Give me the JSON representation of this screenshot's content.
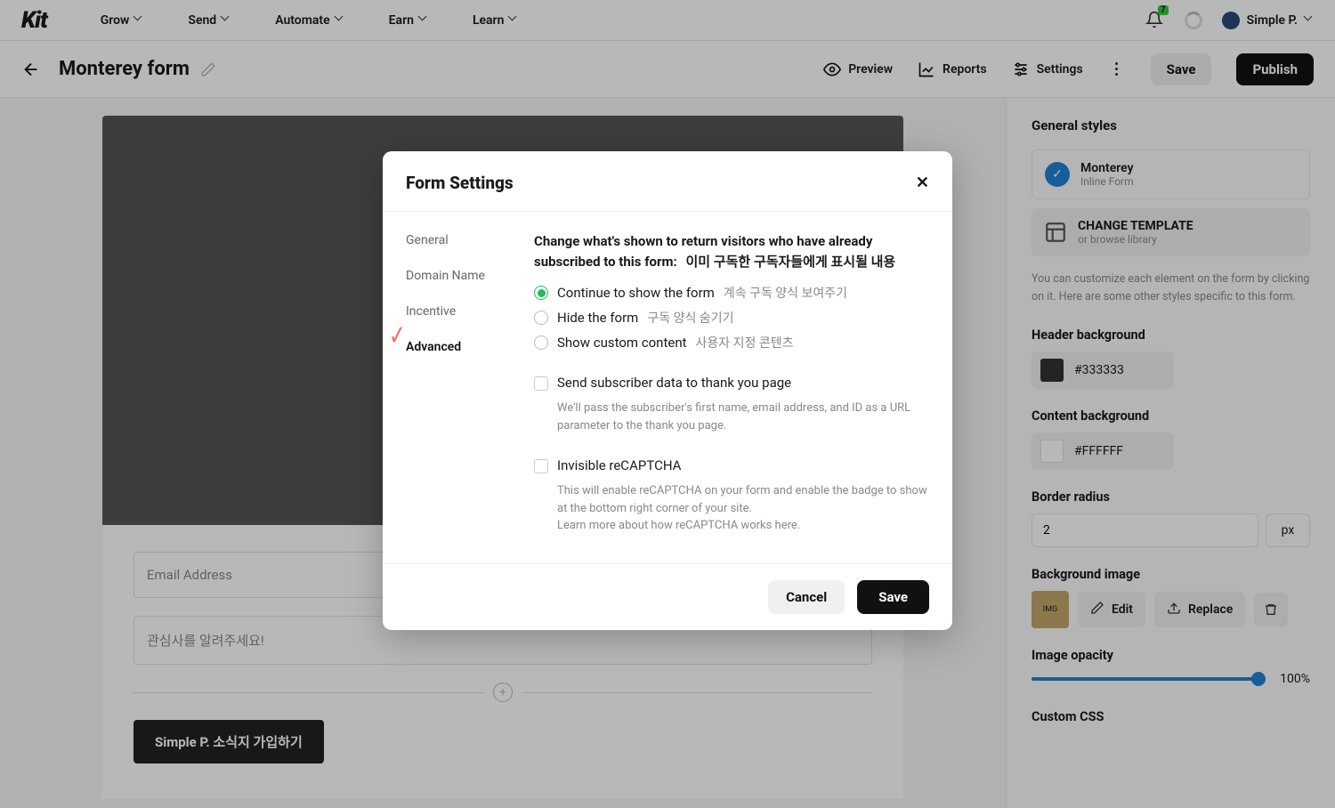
{
  "brand": "Kit",
  "topnav": {
    "grow": "Grow",
    "send": "Send",
    "automate": "Automate",
    "earn": "Earn",
    "learn": "Learn"
  },
  "notifications_count": "7",
  "user_name": "Simple P.",
  "page": {
    "title": "Monterey form",
    "preview": "Preview",
    "reports": "Reports",
    "settings": "Settings",
    "save": "Save",
    "publish": "Publish"
  },
  "form": {
    "email_ph": "Email Address",
    "interest_ph": "관심사를 알려주세요!",
    "subscribe": "Simple P. 소식지 가입하기"
  },
  "panel": {
    "heading": "General styles",
    "template_name": "Monterey",
    "template_type": "Inline Form",
    "change_template": "CHANGE TEMPLATE",
    "change_sub": "or browse library",
    "note": "You can customize each element on the form by clicking on it. Here are some other styles specific to this form.",
    "header_bg_label": "Header background",
    "header_bg_value": "#333333",
    "content_bg_label": "Content background",
    "content_bg_value": "#FFFFFF",
    "radius_label": "Border radius",
    "radius_value": "2",
    "radius_unit": "px",
    "bgimage_label": "Background image",
    "edit": "Edit",
    "replace": "Replace",
    "opacity_label": "Image opacity",
    "opacity_value": "100%",
    "customcss_label": "Custom CSS"
  },
  "modal": {
    "title": "Form Settings",
    "nav": {
      "general": "General",
      "domain": "Domain Name",
      "incentive": "Incentive",
      "advanced": "Advanced"
    },
    "lead_a": "Change what's shown to return visitors who have already subscribed to this form:",
    "lead_b": "이미 구독한 구독자들에게 표시될 내용",
    "opt1": "Continue to show the form",
    "opt1_kr": "계속 구독 양식 보여주기",
    "opt2": "Hide the form",
    "opt2_kr": "구독 양식 숨기기",
    "opt3": "Show custom content",
    "opt3_kr": "사용자 지정 콘텐츠",
    "chk1": "Send subscriber data to thank you page",
    "chk1_help": "We'll pass the subscriber's first name, email address, and ID as a URL parameter to the thank you page.",
    "chk2": "Invisible reCAPTCHA",
    "chk2_help1": "This will enable reCAPTCHA on your form and enable the badge to show at the bottom right corner of your site.",
    "chk2_help2": "Learn more about how reCAPTCHA works here.",
    "cancel": "Cancel",
    "save": "Save"
  }
}
